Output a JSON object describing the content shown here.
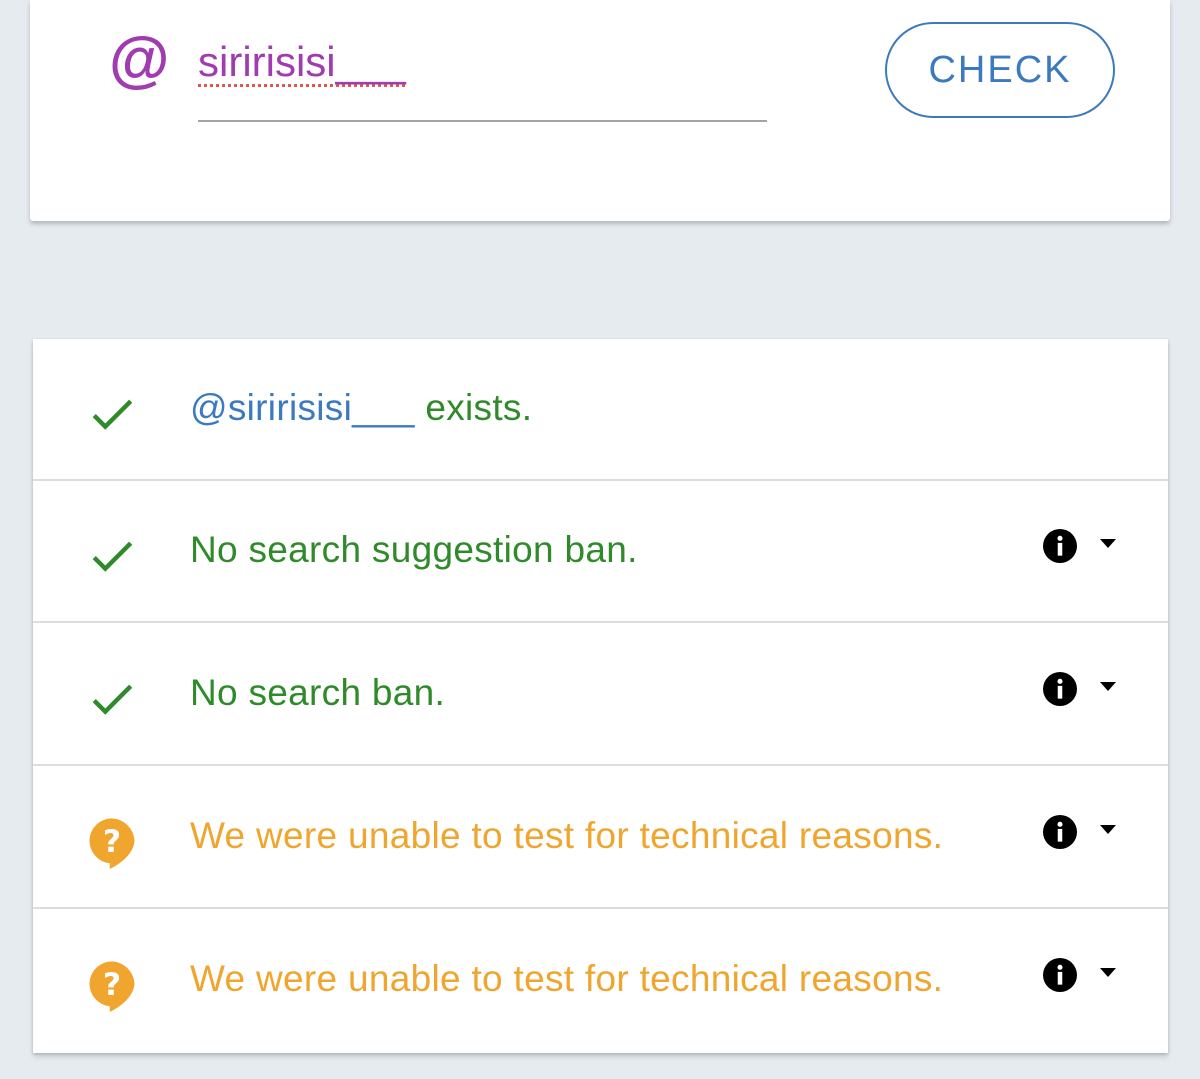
{
  "search": {
    "at_symbol": "@",
    "username_value": "siririsisi___",
    "check_label": "CHECK"
  },
  "results": [
    {
      "status": "ok",
      "icon": "check-icon",
      "handle": "@siririsisi___",
      "text": " exists.",
      "has_info": false
    },
    {
      "status": "ok",
      "icon": "check-icon",
      "text": "No search suggestion ban.",
      "has_info": true
    },
    {
      "status": "ok",
      "icon": "check-icon",
      "text": "No search ban.",
      "has_info": true
    },
    {
      "status": "unknown",
      "icon": "question-bubble-icon",
      "text": "We were unable to test for technical reasons.",
      "has_info": true
    },
    {
      "status": "unknown",
      "icon": "question-bubble-icon",
      "text": "We were unable to test for technical reasons.",
      "has_info": true
    }
  ],
  "colors": {
    "accent_purple": "#a03cb0",
    "link_blue": "#3b7abf",
    "ok_green": "#2f8a2a",
    "warn_orange": "#f0a52e",
    "background": "#e6ebf0"
  }
}
